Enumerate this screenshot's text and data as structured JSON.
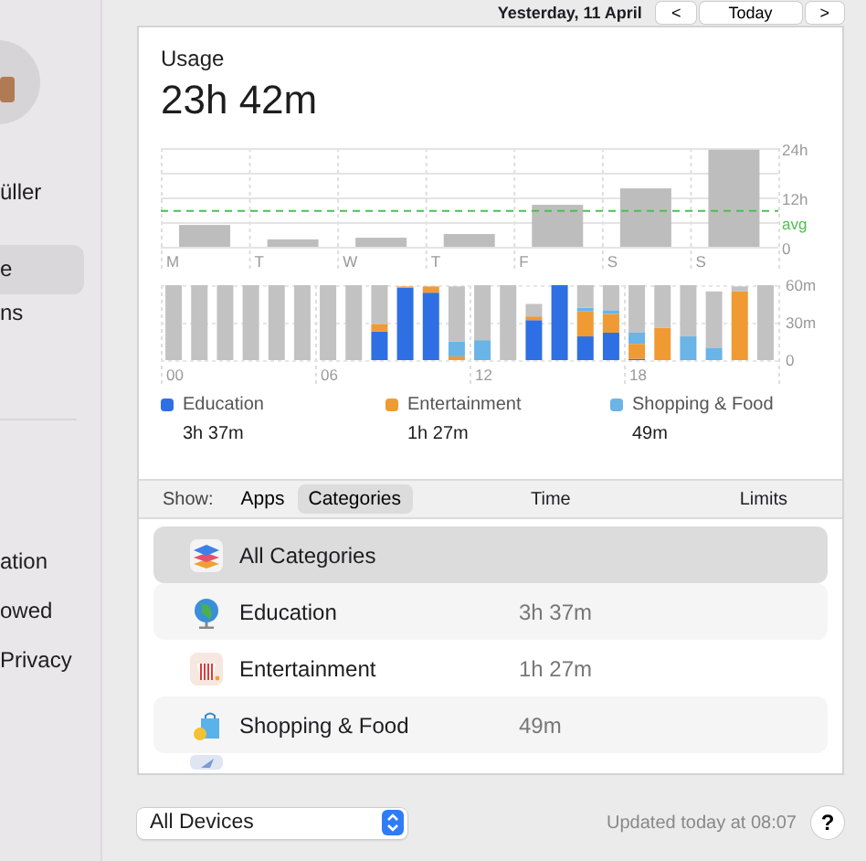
{
  "header": {
    "date_picker": "Yesterday, 11 April",
    "prev": "<",
    "today": "Today",
    "next": ">"
  },
  "sidebar": {
    "user_name": "üller",
    "items": [
      {
        "label": "e",
        "selected": true
      },
      {
        "label": "ns",
        "selected": false
      },
      {
        "label": "ation",
        "selected": false
      },
      {
        "label": "owed",
        "selected": false
      },
      {
        "label": "Privacy",
        "selected": false
      }
    ]
  },
  "usage": {
    "label": "Usage",
    "total": "23h 42m",
    "weekly": {
      "chart_data": {
        "type": "bar",
        "categories": [
          "M",
          "T",
          "W",
          "T",
          "F",
          "S",
          "S"
        ],
        "values": [
          5.3,
          1.8,
          2.2,
          3.1,
          10.2,
          14.2,
          23.6
        ],
        "ylim": [
          0,
          24
        ],
        "yticks": [
          {
            "value": 0,
            "label": "0"
          },
          {
            "value": 12,
            "label": "12h"
          },
          {
            "value": 24,
            "label": "24h"
          }
        ],
        "ref_lines": [
          {
            "axis": "y",
            "value": 8.7,
            "label": "avg"
          }
        ]
      }
    },
    "hourly": {
      "chart_data": {
        "type": "bar",
        "stacked": true,
        "x": [
          0,
          1,
          2,
          3,
          4,
          5,
          6,
          7,
          8,
          9,
          10,
          11,
          12,
          13,
          14,
          15,
          16,
          17,
          18,
          19,
          20,
          21,
          22,
          23
        ],
        "xlim": [
          -0.5,
          23.5
        ],
        "ylim": [
          0,
          60
        ],
        "xticks": [
          {
            "value": 0,
            "label": "00"
          },
          {
            "value": 6,
            "label": "06"
          },
          {
            "value": 12,
            "label": "12"
          },
          {
            "value": 18,
            "label": "18"
          }
        ],
        "yticks": [
          {
            "value": 0,
            "label": "0"
          },
          {
            "value": 30,
            "label": "30m"
          },
          {
            "value": 60,
            "label": "60m"
          }
        ],
        "series": [
          {
            "name": "Education",
            "color": "#2f6fe4",
            "values": [
              0,
              0,
              0,
              0,
              0,
              0,
              0,
              0,
              23,
              58,
              54,
              0,
              0,
              0,
              32,
              60,
              19,
              22,
              1,
              0,
              0,
              0,
              0,
              0
            ]
          },
          {
            "name": "Entertainment",
            "color": "#f09a34",
            "values": [
              0,
              0,
              0,
              0,
              0,
              0,
              0,
              0,
              6,
              1,
              5,
              3,
              0,
              0,
              3,
              0,
              20,
              15,
              12,
              26,
              0,
              0,
              55,
              0
            ]
          },
          {
            "name": "Shopping & Food",
            "color": "#6ab4e6",
            "values": [
              0,
              0,
              0,
              0,
              0,
              0,
              0,
              0,
              0,
              0,
              0,
              12,
              16,
              0,
              0,
              0,
              3,
              3,
              9,
              0,
              19,
              10,
              0,
              0
            ]
          },
          {
            "color": "#c2c2c2",
            "values": [
              60,
              60,
              60,
              60,
              60,
              60,
              60,
              60,
              31,
              0,
              0,
              44,
              44,
              60,
              10,
              0,
              18,
              20,
              38,
              34,
              41,
              45,
              4,
              60
            ]
          }
        ]
      }
    },
    "legend": [
      {
        "time": "3h 37m"
      },
      {
        "time": "1h 27m"
      },
      {
        "time": "49m"
      }
    ]
  },
  "table": {
    "show_label": "Show:",
    "tabs": [
      {
        "label": "Apps",
        "selected": false
      },
      {
        "label": "Categories",
        "selected": true
      }
    ],
    "columns": [
      "Time",
      "Limits"
    ],
    "rows": [
      {
        "name": "All Categories",
        "selected": true
      },
      {
        "name": "Education",
        "time": "3h 37m",
        "selected": false
      },
      {
        "name": "Entertainment",
        "time": "1h 27m",
        "selected": false
      },
      {
        "name": "Shopping & Food",
        "time": "49m",
        "selected": false
      }
    ]
  },
  "footer": {
    "device": "All Devices",
    "updated": "Updated today at 08:07",
    "help": "?"
  }
}
